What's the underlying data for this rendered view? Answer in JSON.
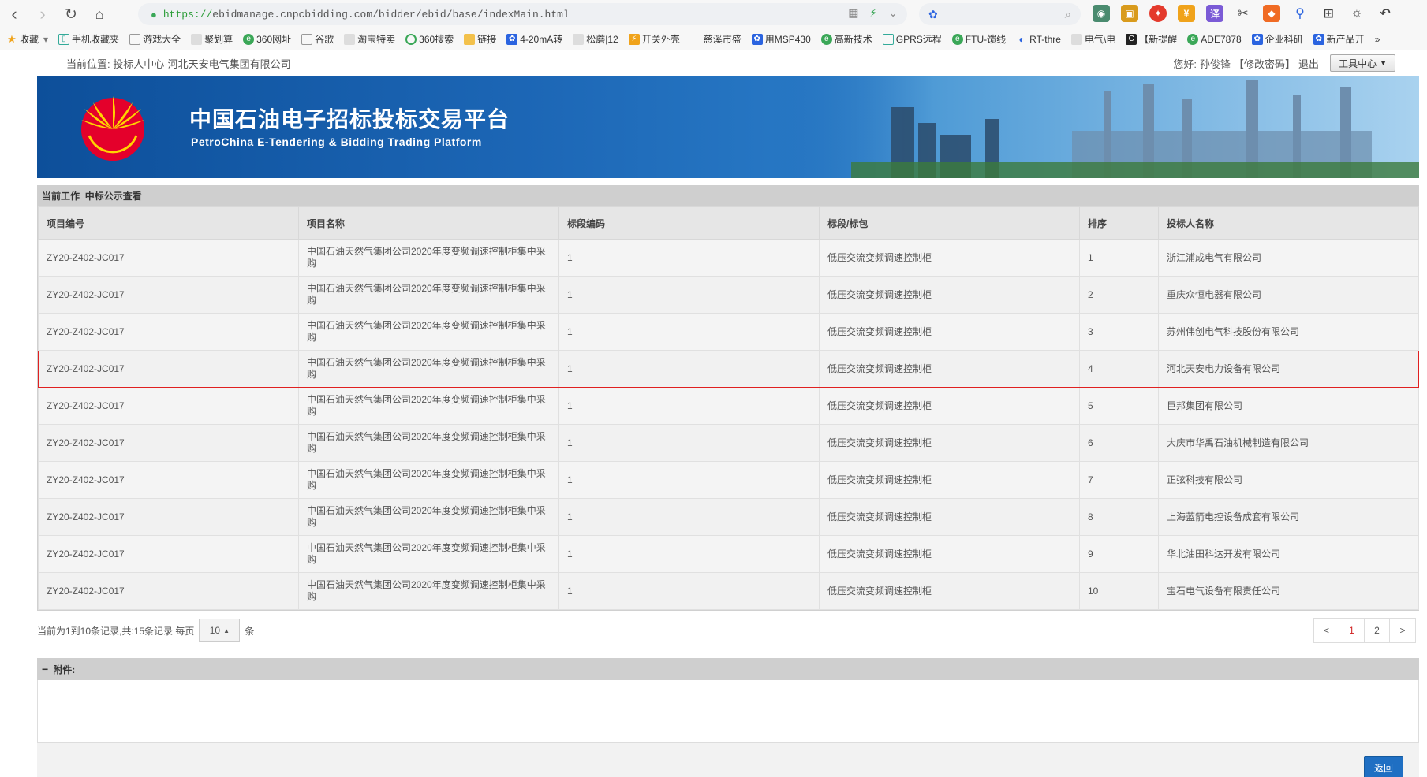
{
  "browser": {
    "url": "https://ebidmanage.cnpcbidding.com/bidder/ebid/base/indexMain.html",
    "bookmarks": [
      "收藏",
      "手机收藏夹",
      "游戏大全",
      "聚划算",
      "360网址",
      "谷歌",
      "淘宝特卖",
      "360搜索",
      "链接",
      "4-20mA转",
      "松蘑|12",
      "开关外壳",
      "慈溪市盛",
      "用MSP430",
      "高新技术",
      "GPRS远程",
      "FTU-馈线",
      "RT-thre",
      "电气\\电",
      "【新提醒",
      "ADE7878",
      "企业科研",
      "新产品开"
    ]
  },
  "header": {
    "location_label": "当前位置:",
    "location_value": "投标人中心-河北天安电气集团有限公司",
    "greeting": "您好:",
    "user_name": "孙俊锋",
    "change_password": "【修改密码】",
    "logout": "退出",
    "tool_center": "工具中心"
  },
  "banner": {
    "title_cn": "中国石油电子招标投标交易平台",
    "title_en": "PetroChina E-Tendering & Bidding Trading Platform"
  },
  "work": {
    "label": "当前工作",
    "value": "中标公示查看"
  },
  "table": {
    "columns": [
      "项目编号",
      "项目名称",
      "标段编码",
      "标段/标包",
      "排序",
      "投标人名称"
    ],
    "rows": [
      [
        "ZY20-Z402-JC017",
        "中国石油天然气集团公司2020年度变频调速控制柜集中采购",
        "1",
        "低压交流变频调速控制柜",
        "1",
        "浙江浦成电气有限公司"
      ],
      [
        "ZY20-Z402-JC017",
        "中国石油天然气集团公司2020年度变频调速控制柜集中采购",
        "1",
        "低压交流变频调速控制柜",
        "2",
        "重庆众恒电器有限公司"
      ],
      [
        "ZY20-Z402-JC017",
        "中国石油天然气集团公司2020年度变频调速控制柜集中采购",
        "1",
        "低压交流变频调速控制柜",
        "3",
        "苏州伟创电气科技股份有限公司"
      ],
      [
        "ZY20-Z402-JC017",
        "中国石油天然气集团公司2020年度变频调速控制柜集中采购",
        "1",
        "低压交流变频调速控制柜",
        "4",
        "河北天安电力设备有限公司"
      ],
      [
        "ZY20-Z402-JC017",
        "中国石油天然气集团公司2020年度变频调速控制柜集中采购",
        "1",
        "低压交流变频调速控制柜",
        "5",
        "巨邦集团有限公司"
      ],
      [
        "ZY20-Z402-JC017",
        "中国石油天然气集团公司2020年度变频调速控制柜集中采购",
        "1",
        "低压交流变频调速控制柜",
        "6",
        "大庆市华禹石油机械制造有限公司"
      ],
      [
        "ZY20-Z402-JC017",
        "中国石油天然气集团公司2020年度变频调速控制柜集中采购",
        "1",
        "低压交流变频调速控制柜",
        "7",
        "正弦科技有限公司"
      ],
      [
        "ZY20-Z402-JC017",
        "中国石油天然气集团公司2020年度变频调速控制柜集中采购",
        "1",
        "低压交流变频调速控制柜",
        "8",
        "上海蓝箭电控设备成套有限公司"
      ],
      [
        "ZY20-Z402-JC017",
        "中国石油天然气集团公司2020年度变频调速控制柜集中采购",
        "1",
        "低压交流变频调速控制柜",
        "9",
        "华北油田科达开发有限公司"
      ],
      [
        "ZY20-Z402-JC017",
        "中国石油天然气集团公司2020年度变频调速控制柜集中采购",
        "1",
        "低压交流变频调速控制柜",
        "10",
        "宝石电气设备有限责任公司"
      ]
    ]
  },
  "pager": {
    "info_prefix": "当前为1到10条记录,共:15条记录 每页",
    "page_size": "10",
    "info_suffix": "条",
    "prev": "<",
    "pages": [
      "1",
      "2"
    ],
    "next": ">"
  },
  "attachment": {
    "label": "附件:"
  },
  "footer": {
    "back": "返回"
  },
  "colors": {
    "highlight": "#e02020",
    "accent": "#1f6fc3",
    "banner": "#1c66b5"
  }
}
